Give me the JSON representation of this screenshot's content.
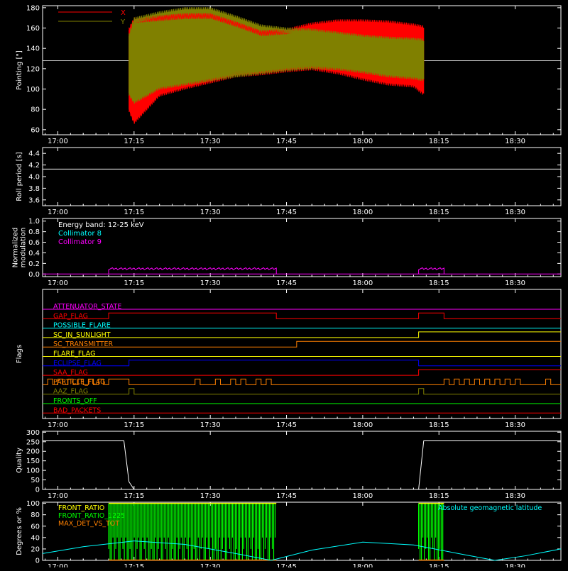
{
  "colors": {
    "background": "#000000",
    "axes": "#ffffff",
    "x_series": "#ff0000",
    "y_series": "#808000",
    "cyan": "#00ffff",
    "magenta": "#ff00ff",
    "green": "#00ff00",
    "yellow": "#ffff00",
    "orange": "#ff8000",
    "blue": "#0000ff",
    "red": "#ff0000",
    "olive": "#808000"
  },
  "time_axis": {
    "xlim": [
      "16:57",
      "18:39"
    ],
    "ticks": [
      {
        "t": "17:00",
        "label": "17:00"
      },
      {
        "t": "17:15",
        "label": "17:15"
      },
      {
        "t": "17:30",
        "label": "17:30"
      },
      {
        "t": "17:45",
        "label": "17:45"
      },
      {
        "t": "18:00",
        "label": "18:00"
      },
      {
        "t": "18:15",
        "label": "18:15"
      },
      {
        "t": "18:30",
        "label": "18:30"
      }
    ]
  },
  "chart_data": [
    {
      "id": "pointing",
      "type": "area",
      "ylabel": "Pointing [\"]",
      "ylim": [
        55,
        182
      ],
      "yticks": [
        60,
        80,
        100,
        120,
        140,
        160,
        180
      ],
      "reference_line": 128,
      "legend": [
        {
          "name": "X",
          "color": "#ff0000"
        },
        {
          "name": "Y",
          "color": "#808000"
        }
      ],
      "series": [
        {
          "name": "X",
          "color": "#ff0000",
          "times": [
            "17:14",
            "17:15",
            "17:20",
            "17:25",
            "17:30",
            "17:35",
            "17:40",
            "17:45",
            "17:50",
            "17:55",
            "18:00",
            "18:05",
            "18:10",
            "18:12"
          ],
          "upper": [
            158,
            168,
            170,
            172,
            172,
            164,
            155,
            157,
            163,
            166,
            166,
            165,
            162,
            160
          ],
          "lower": [
            80,
            68,
            95,
            102,
            108,
            114,
            116,
            119,
            121,
            117,
            111,
            106,
            104,
            96
          ]
        },
        {
          "name": "Y",
          "color": "#808000",
          "times": [
            "17:14",
            "17:15",
            "17:20",
            "17:25",
            "17:30",
            "17:35",
            "17:40",
            "17:45",
            "17:50",
            "17:55",
            "18:00",
            "18:05",
            "18:10",
            "18:12"
          ],
          "upper": [
            152,
            168,
            174,
            178,
            178,
            170,
            161,
            158,
            157,
            154,
            151,
            149,
            148,
            147
          ],
          "lower": [
            96,
            88,
            102,
            106,
            110,
            114,
            117,
            120,
            122,
            121,
            118,
            114,
            112,
            110
          ]
        }
      ]
    },
    {
      "id": "roll_period",
      "type": "line",
      "ylabel": "Roll period [s]",
      "ylim": [
        3.5,
        4.5
      ],
      "yticks": [
        3.6,
        3.8,
        4.0,
        4.2,
        4.4
      ],
      "ytick_labels": [
        "3.6",
        "3.8",
        "4.0",
        "4.2",
        "4.4"
      ],
      "series": [
        {
          "name": "",
          "color": "#ffffff",
          "times": [
            "16:57",
            "18:39"
          ],
          "values": [
            4.13,
            4.13
          ]
        }
      ]
    },
    {
      "id": "modulation",
      "type": "line",
      "ylabel": "Normalized modulation",
      "ylabel_lines": [
        "Normalized",
        "modulation"
      ],
      "ylim": [
        -0.05,
        1.05
      ],
      "yticks": [
        0.0,
        0.2,
        0.4,
        0.6,
        0.8,
        1.0
      ],
      "ytick_labels": [
        "0.0",
        "0.2",
        "0.4",
        "0.6",
        "0.8",
        "1.0"
      ],
      "annotations": [
        {
          "text": "Energy band: 12-25 keV",
          "color": "#ffffff"
        },
        {
          "text": "Collimator 8",
          "color": "#00ffff"
        },
        {
          "text": "Collimator 9",
          "color": "#ff00ff"
        }
      ],
      "series": [
        {
          "name": "Collimator 9",
          "color": "#ff00ff",
          "segments": [
            {
              "from": "17:10",
              "to": "17:43",
              "level": 0.1
            },
            {
              "from": "18:11",
              "to": "18:16",
              "level": 0.1
            }
          ]
        }
      ]
    },
    {
      "id": "flags",
      "type": "line",
      "ylabel": "Flags",
      "flags": [
        {
          "name": "ATTENUATOR_STATE",
          "color": "#ff00ff",
          "steps": []
        },
        {
          "name": "GAP_FLAG",
          "color": "#ff0000",
          "steps": [
            [
              "17:10",
              1
            ],
            [
              "17:43",
              0
            ],
            [
              "18:11",
              1
            ],
            [
              "18:16",
              0
            ]
          ]
        },
        {
          "name": "POSSIBLE_FLARE",
          "color": "#00ffff",
          "steps": []
        },
        {
          "name": "SC_IN_SUNLIGHT",
          "color": "#ffff00",
          "steps": [
            [
              "17:14",
              0
            ],
            [
              "18:11",
              1
            ]
          ]
        },
        {
          "name": "SC_TRANSMITTER",
          "color": "#ff8000",
          "steps": [
            [
              "17:43",
              0
            ],
            [
              "17:47",
              1
            ]
          ]
        },
        {
          "name": "FLARE_FLAG",
          "color": "#ffff00",
          "steps": []
        },
        {
          "name": "ECLIPSE_FLAG",
          "color": "#0000ff",
          "steps": [
            [
              "17:14",
              1
            ],
            [
              "18:11",
              0
            ]
          ]
        },
        {
          "name": "SAA_FLAG",
          "color": "#ff0000",
          "steps": [
            [
              "17:41",
              0
            ],
            [
              "18:11",
              1
            ]
          ]
        },
        {
          "name": "PARTICLE_FLAG",
          "color": "#ff8000",
          "steps": [
            [
              "16:58",
              1
            ],
            [
              "16:59",
              0
            ],
            [
              "17:00",
              1
            ],
            [
              "17:01",
              0
            ],
            [
              "17:02",
              1
            ],
            [
              "17:03",
              0
            ],
            [
              "17:04",
              1
            ],
            [
              "17:05",
              0
            ],
            [
              "17:06",
              1
            ],
            [
              "17:07",
              0
            ],
            [
              "17:08",
              1
            ],
            [
              "17:09",
              0
            ],
            [
              "17:10",
              1
            ],
            [
              "17:14",
              0
            ],
            [
              "17:27",
              1
            ],
            [
              "17:28",
              0
            ],
            [
              "17:31",
              1
            ],
            [
              "17:32",
              0
            ],
            [
              "17:34",
              1
            ],
            [
              "17:35",
              0
            ],
            [
              "17:36",
              1
            ],
            [
              "17:37",
              0
            ],
            [
              "17:39",
              1
            ],
            [
              "17:40",
              0
            ],
            [
              "17:41",
              1
            ],
            [
              "17:42",
              0
            ],
            [
              "18:16",
              1
            ],
            [
              "18:17",
              0
            ],
            [
              "18:18",
              1
            ],
            [
              "18:19",
              0
            ],
            [
              "18:20",
              1
            ],
            [
              "18:21",
              0
            ],
            [
              "18:22",
              1
            ],
            [
              "18:23",
              0
            ],
            [
              "18:24",
              1
            ],
            [
              "18:25",
              0
            ],
            [
              "18:26",
              1
            ],
            [
              "18:27",
              0
            ],
            [
              "18:28",
              1
            ],
            [
              "18:29",
              0
            ],
            [
              "18:30",
              1
            ],
            [
              "18:31",
              0
            ],
            [
              "18:36",
              1
            ],
            [
              "18:37",
              0
            ]
          ]
        },
        {
          "name": "AAZ_FLAG",
          "color": "#808000",
          "steps": [
            [
              "17:14",
              1
            ],
            [
              "17:15",
              0
            ],
            [
              "18:11",
              1
            ],
            [
              "18:12",
              0
            ]
          ]
        },
        {
          "name": "FRONTS_OFF",
          "color": "#00ff00",
          "steps": []
        },
        {
          "name": "BAD_PACKETS",
          "color": "#ff0000",
          "steps": []
        }
      ]
    },
    {
      "id": "quality",
      "type": "line",
      "ylabel": "Quality",
      "ylim": [
        0,
        305
      ],
      "yticks": [
        0,
        50,
        100,
        150,
        200,
        250,
        300
      ],
      "series": [
        {
          "name": "",
          "color": "#ffffff",
          "times": [
            "16:57",
            "17:13",
            "17:14",
            "17:15",
            "18:11",
            "18:12",
            "18:39"
          ],
          "values": [
            255,
            255,
            40,
            0,
            0,
            255,
            255
          ]
        }
      ]
    },
    {
      "id": "ratios",
      "type": "line",
      "ylabel": "Degrees or %",
      "ylim": [
        0,
        102
      ],
      "yticks": [
        0,
        20,
        40,
        60,
        80,
        100
      ],
      "legend": [
        {
          "name": "FRONT_RATIO",
          "color": "#ffff00"
        },
        {
          "name": "FRONT_RATIO_1225",
          "color": "#00ff00"
        },
        {
          "name": "MAX_DET_VS_TOT",
          "color": "#ff8000"
        }
      ],
      "right_label": {
        "text": "Absolute geomagnetic latitude",
        "color": "#00ffff"
      },
      "front_ratio_1225_intervals": [
        [
          "17:10",
          "17:43"
        ],
        [
          "18:11",
          "18:16"
        ]
      ],
      "geomagnetic_latitude": {
        "times": [
          "16:57",
          "17:05",
          "17:15",
          "17:25",
          "17:35",
          "17:42",
          "17:50",
          "18:00",
          "18:10",
          "18:20",
          "18:26",
          "18:32",
          "18:39"
        ],
        "values": [
          12,
          24,
          34,
          28,
          12,
          0,
          18,
          32,
          27,
          10,
          0,
          8,
          20
        ]
      }
    }
  ]
}
